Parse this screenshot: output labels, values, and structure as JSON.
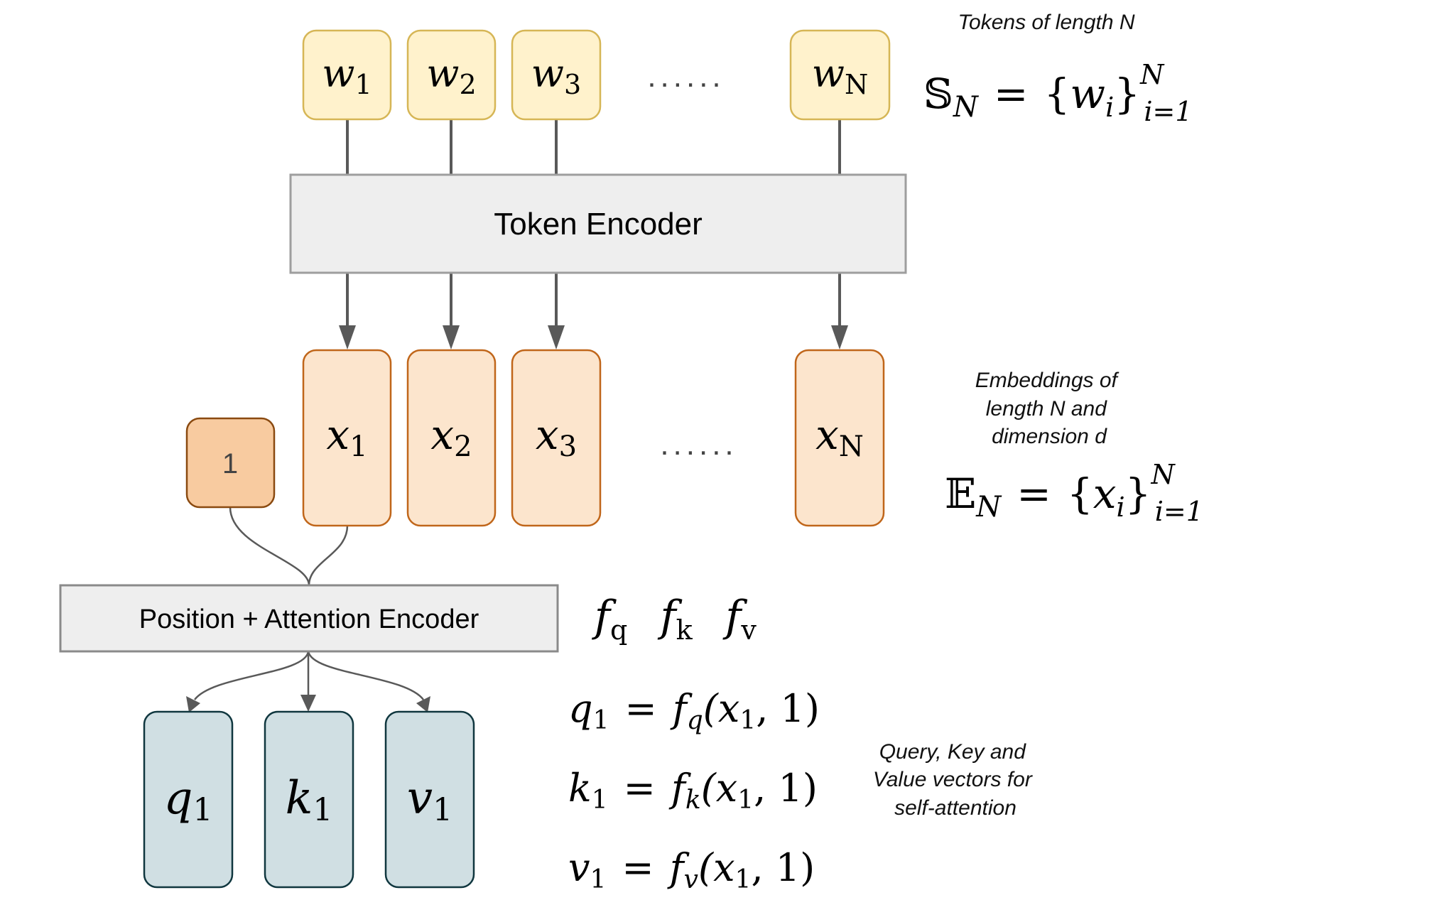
{
  "tokens": {
    "caption": "Tokens of length N",
    "items": [
      {
        "base": "w",
        "sub": "1"
      },
      {
        "base": "w",
        "sub": "2"
      },
      {
        "base": "w",
        "sub": "3"
      },
      {
        "base": "w",
        "sub": "N"
      }
    ],
    "ellipsis": "......",
    "formula": {
      "set": "𝕊",
      "set_sub": "N",
      "eq": "=",
      "open": "{",
      "elem": "w",
      "elem_sub": "i",
      "close": "}",
      "sup": "N",
      "sub": "i=1"
    }
  },
  "token_encoder": {
    "label": "Token Encoder"
  },
  "embeddings": {
    "caption_lines": [
      "Embeddings of",
      "length N and",
      "dimension d"
    ],
    "items": [
      {
        "base": "x",
        "sub": "1"
      },
      {
        "base": "x",
        "sub": "2"
      },
      {
        "base": "x",
        "sub": "3"
      },
      {
        "base": "x",
        "sub": "N"
      }
    ],
    "ellipsis": "......",
    "formula": {
      "set": "𝔼",
      "set_sub": "N",
      "eq": "=",
      "open": "{",
      "elem": "x",
      "elem_sub": "i",
      "close": "}",
      "sup": "N",
      "sub": "i=1"
    }
  },
  "position": {
    "label": "1"
  },
  "attention_encoder": {
    "label": "Position + Attention Encoder",
    "functions": [
      {
        "base": "f",
        "sub": "q"
      },
      {
        "base": "f",
        "sub": "k"
      },
      {
        "base": "f",
        "sub": "v"
      }
    ]
  },
  "qkv": {
    "items": [
      {
        "base": "q",
        "sub": "1"
      },
      {
        "base": "k",
        "sub": "1"
      },
      {
        "base": "v",
        "sub": "1"
      }
    ],
    "equations": [
      {
        "lhs": "q",
        "lhs_sub": "1",
        "fn": "f",
        "fn_sub": "q",
        "args": "(x",
        "args_sub": "1",
        "rest": ", 1)"
      },
      {
        "lhs": "k",
        "lhs_sub": "1",
        "fn": "f",
        "fn_sub": "k",
        "args": "(x",
        "args_sub": "1",
        "rest": ", 1)"
      },
      {
        "lhs": "v",
        "lhs_sub": "1",
        "fn": "f",
        "fn_sub": "v",
        "args": "(x",
        "args_sub": "1",
        "rest": ", 1)"
      }
    ],
    "caption_lines": [
      "Query, Key and",
      "Value vectors for",
      "self-attention"
    ]
  },
  "colors": {
    "token_fill": "#fff2cc",
    "token_stroke": "#d6b656",
    "embed_fill": "#fce5cd",
    "embed_stroke": "#c0661a",
    "pos_fill": "#f8cba0",
    "pos_stroke": "#8a4a10",
    "encoder_fill": "#eeeeee",
    "encoder_stroke": "#9e9e9e",
    "qkv_fill": "#d0dfe3",
    "qkv_stroke": "#10373f",
    "arrow": "#595959"
  }
}
